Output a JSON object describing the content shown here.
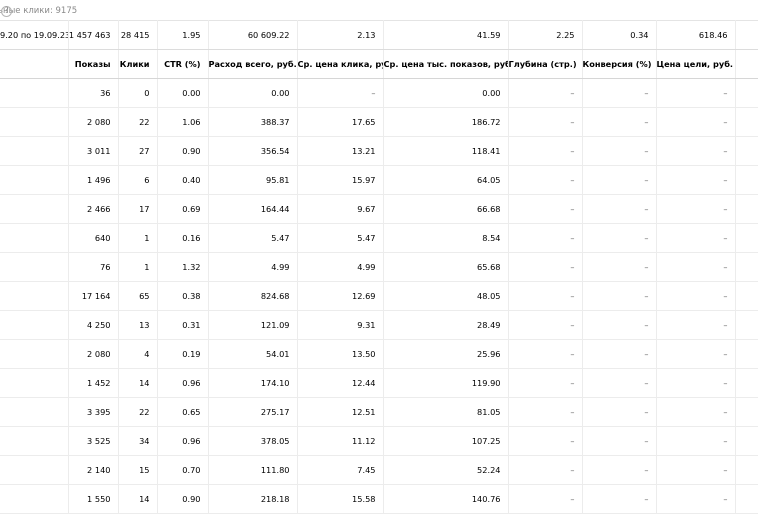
{
  "top_note": "ьные клики: 9175",
  "totals": {
    "period": "9.20 по 19.09.23",
    "values": [
      "1 457 463",
      "28 415",
      "1.95",
      "60 609.22",
      "2.13",
      "41.59",
      "2.25",
      "0.34",
      "618.46"
    ]
  },
  "headers": [
    "Показы",
    "Клики",
    "CTR (%)",
    "Расход всего, руб.",
    "Ср. цена клика, руб.",
    "Ср. цена тыс. показов, руб.",
    "Глубина (стр.)",
    "Конверсия (%)",
    "Цена цели, руб."
  ],
  "rows": [
    [
      "36",
      "0",
      "0.00",
      "0.00",
      "–",
      "0.00",
      "–",
      "–",
      "–"
    ],
    [
      "2 080",
      "22",
      "1.06",
      "388.37",
      "17.65",
      "186.72",
      "–",
      "–",
      "–"
    ],
    [
      "3 011",
      "27",
      "0.90",
      "356.54",
      "13.21",
      "118.41",
      "–",
      "–",
      "–"
    ],
    [
      "1 496",
      "6",
      "0.40",
      "95.81",
      "15.97",
      "64.05",
      "–",
      "–",
      "–"
    ],
    [
      "2 466",
      "17",
      "0.69",
      "164.44",
      "9.67",
      "66.68",
      "–",
      "–",
      "–"
    ],
    [
      "640",
      "1",
      "0.16",
      "5.47",
      "5.47",
      "8.54",
      "–",
      "–",
      "–"
    ],
    [
      "76",
      "1",
      "1.32",
      "4.99",
      "4.99",
      "65.68",
      "–",
      "–",
      "–"
    ],
    [
      "17 164",
      "65",
      "0.38",
      "824.68",
      "12.69",
      "48.05",
      "–",
      "–",
      "–"
    ],
    [
      "4 250",
      "13",
      "0.31",
      "121.09",
      "9.31",
      "28.49",
      "–",
      "–",
      "–"
    ],
    [
      "2 080",
      "4",
      "0.19",
      "54.01",
      "13.50",
      "25.96",
      "–",
      "–",
      "–"
    ],
    [
      "1 452",
      "14",
      "0.96",
      "174.10",
      "12.44",
      "119.90",
      "–",
      "–",
      "–"
    ],
    [
      "3 395",
      "22",
      "0.65",
      "275.17",
      "12.51",
      "81.05",
      "–",
      "–",
      "–"
    ],
    [
      "3 525",
      "34",
      "0.96",
      "378.05",
      "11.12",
      "107.25",
      "–",
      "–",
      "–"
    ],
    [
      "2 140",
      "15",
      "0.70",
      "111.80",
      "7.45",
      "52.24",
      "–",
      "–",
      "–"
    ],
    [
      "1 550",
      "14",
      "0.90",
      "218.18",
      "15.58",
      "140.76",
      "–",
      "–",
      "–"
    ]
  ]
}
